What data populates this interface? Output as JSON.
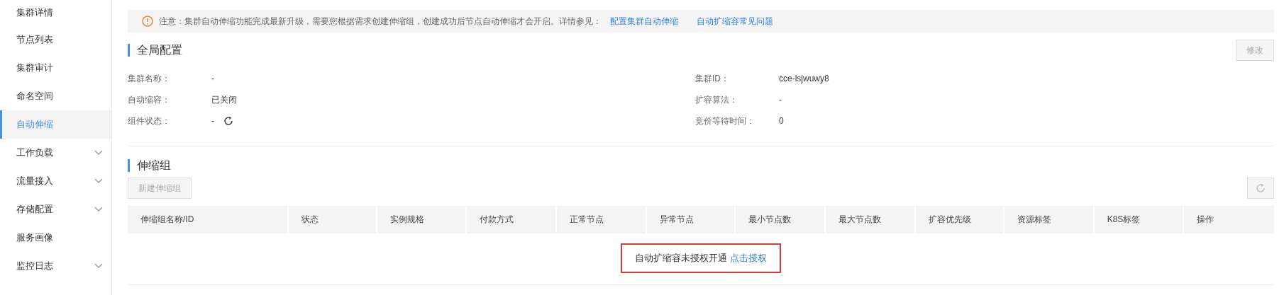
{
  "sidebar": {
    "items": [
      {
        "label": "集群详情",
        "selected": false,
        "expandable": false
      },
      {
        "label": "节点列表",
        "selected": false,
        "expandable": false
      },
      {
        "label": "集群审计",
        "selected": false,
        "expandable": false
      },
      {
        "label": "命名空间",
        "selected": false,
        "expandable": false
      },
      {
        "label": "自动伸缩",
        "selected": true,
        "expandable": false
      },
      {
        "label": "工作负载",
        "selected": false,
        "expandable": true
      },
      {
        "label": "流量接入",
        "selected": false,
        "expandable": true
      },
      {
        "label": "存储配置",
        "selected": false,
        "expandable": true
      },
      {
        "label": "服务画像",
        "selected": false,
        "expandable": false
      },
      {
        "label": "监控日志",
        "selected": false,
        "expandable": true
      }
    ]
  },
  "notice": {
    "text": "注意：集群自动伸缩功能完成最新升级，需要您根据需求创建伸缩组，创建成功后节点自动伸缩才会开启。详情参见：",
    "links": [
      "配置集群自动伸缩",
      "自动扩缩容常见问题"
    ]
  },
  "global_config": {
    "title": "全局配置",
    "edit_button": {
      "label": "修改",
      "disabled": true
    },
    "left_fields": [
      {
        "label": "集群名称：",
        "value": "-",
        "refresh": false
      },
      {
        "label": "自动缩容：",
        "value": "已关闭",
        "refresh": false
      },
      {
        "label": "组件状态：",
        "value": "-",
        "refresh": true
      }
    ],
    "right_fields": [
      {
        "label": "集群ID：",
        "value": "cce-lsjwuwy8",
        "refresh": false
      },
      {
        "label": "扩容算法：",
        "value": "-",
        "refresh": false
      },
      {
        "label": "竞价等待时间：",
        "value": "0",
        "refresh": false
      }
    ]
  },
  "scaling_groups": {
    "title": "伸缩组",
    "new_button": {
      "label": "新建伸缩组",
      "disabled": true
    },
    "table": {
      "columns": [
        "伸缩组名称/ID",
        "状态",
        "实例规格",
        "付款方式",
        "正常节点",
        "异常节点",
        "最小节点数",
        "最大节点数",
        "扩容优先级",
        "资源标签",
        "K8S标签",
        "操作"
      ],
      "empty_text": "自动扩缩容未授权开通",
      "empty_link": "点击授权"
    }
  }
}
